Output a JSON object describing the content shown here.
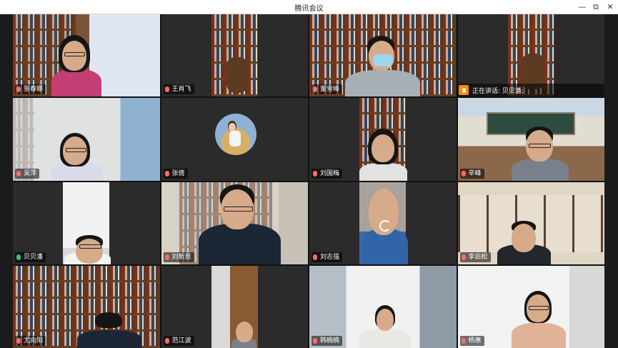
{
  "window": {
    "title": "腾讯会议",
    "minimize": "—",
    "maximize": "⧉",
    "close": "✕"
  },
  "speaking": {
    "text": "正在讲话: 贝贝潘;"
  },
  "participants": [
    {
      "name": "张春娜",
      "mic": "muted"
    },
    {
      "name": "王肖飞",
      "mic": "muted"
    },
    {
      "name": "董雪峰",
      "mic": "muted"
    },
    {
      "name": "",
      "mic": "muted"
    },
    {
      "name": "吴萍",
      "mic": "muted"
    },
    {
      "name": "张倩",
      "mic": "muted"
    },
    {
      "name": "刘国梅",
      "mic": "muted"
    },
    {
      "name": "辛峰",
      "mic": "muted"
    },
    {
      "name": "贝贝潘",
      "mic": "speaking"
    },
    {
      "name": "刘新恩",
      "mic": "muted"
    },
    {
      "name": "刘志强",
      "mic": "muted"
    },
    {
      "name": "李启松",
      "mic": "muted"
    },
    {
      "name": "尤向阳",
      "mic": "muted"
    },
    {
      "name": "范江波",
      "mic": "muted"
    },
    {
      "name": "韩楠楠",
      "mic": "muted"
    },
    {
      "name": "杨惠",
      "mic": "muted"
    }
  ]
}
